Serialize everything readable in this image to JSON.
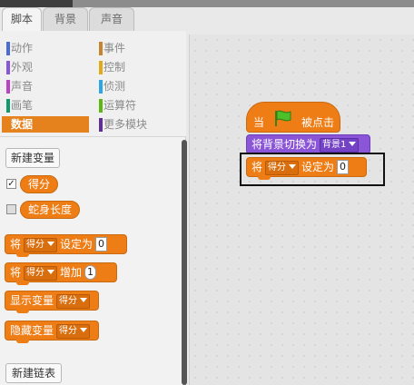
{
  "tabs": [
    "脚本",
    "背景",
    "声音"
  ],
  "categories": {
    "left": [
      {
        "label": "动作",
        "color": "#4a6cd4"
      },
      {
        "label": "外观",
        "color": "#8a55d7"
      },
      {
        "label": "声音",
        "color": "#bb42c3"
      },
      {
        "label": "画笔",
        "color": "#0e9a6c"
      },
      {
        "label": "数据",
        "color": "#ee7d16",
        "active": true
      }
    ],
    "right": [
      {
        "label": "事件",
        "color": "#c88330"
      },
      {
        "label": "控制",
        "color": "#e1a91a"
      },
      {
        "label": "侦测",
        "color": "#2ca5e2"
      },
      {
        "label": "运算符",
        "color": "#5cb712"
      },
      {
        "label": "更多模块",
        "color": "#632d99"
      }
    ]
  },
  "palette": {
    "new_variable": "新建变量",
    "var1": "得分",
    "var1_checked": true,
    "var2": "蛇身长度",
    "var2_checked": false,
    "set_block": {
      "prefix": "将",
      "var": "得分",
      "suffix": "设定为",
      "value": "0"
    },
    "change_block": {
      "prefix": "将",
      "var": "得分",
      "suffix": "增加",
      "value": "1"
    },
    "show_block": {
      "label": "显示变量",
      "var": "得分"
    },
    "hide_block": {
      "label": "隐藏变量",
      "var": "得分"
    },
    "new_list": "新建链表"
  },
  "script": {
    "hat_when": "当",
    "hat_clicked": "被点击",
    "switch_label": "将背景切换为",
    "switch_value": "背景1",
    "set_prefix": "将",
    "set_var": "得分",
    "set_suffix": "设定为",
    "set_value": "0"
  }
}
